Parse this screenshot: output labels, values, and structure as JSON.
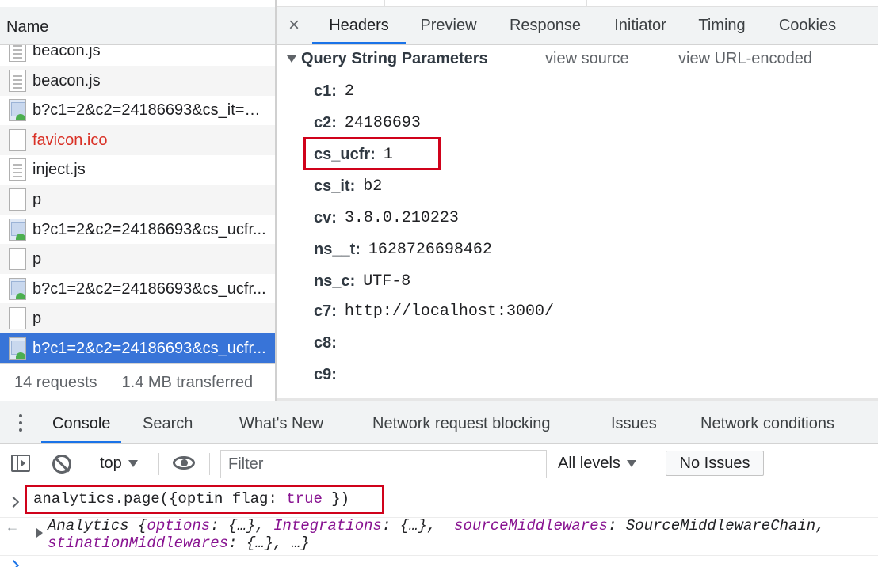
{
  "request_list": {
    "header": "Name",
    "rows": [
      {
        "label": "beacon.js",
        "icon": "script-file-icon",
        "error": false
      },
      {
        "label": "beacon.js",
        "icon": "script-file-icon",
        "error": false
      },
      {
        "label": "b?c1=2&c2=24186693&cs_it=b2...",
        "icon": "image-file-icon",
        "error": false
      },
      {
        "label": "favicon.ico",
        "icon": "blank-file-icon",
        "error": true
      },
      {
        "label": "inject.js",
        "icon": "script-file-icon",
        "error": false
      },
      {
        "label": "p",
        "icon": "blank-file-icon",
        "error": false
      },
      {
        "label": "b?c1=2&c2=24186693&cs_ucfr...",
        "icon": "image-file-icon",
        "error": false
      },
      {
        "label": "p",
        "icon": "blank-file-icon",
        "error": false
      },
      {
        "label": "b?c1=2&c2=24186693&cs_ucfr...",
        "icon": "image-file-icon",
        "error": false
      },
      {
        "label": "p",
        "icon": "blank-file-icon",
        "error": false
      },
      {
        "label": "b?c1=2&c2=24186693&cs_ucfr...",
        "icon": "image-file-icon",
        "error": false,
        "selected": true
      }
    ],
    "status_requests": "14 requests",
    "status_transferred": "1.4 MB transferred"
  },
  "detail": {
    "close_glyph": "×",
    "tabs": [
      "Headers",
      "Preview",
      "Response",
      "Initiator",
      "Timing",
      "Cookies"
    ],
    "active_tab": "Headers",
    "section_title": "Query String Parameters",
    "view_source": "view source",
    "view_url_encoded": "view URL-encoded",
    "params": [
      {
        "key": "c1:",
        "value": "2"
      },
      {
        "key": "c2:",
        "value": "24186693"
      },
      {
        "key": "cs_ucfr:",
        "value": "1"
      },
      {
        "key": "cs_it:",
        "value": "b2"
      },
      {
        "key": "cv:",
        "value": "3.8.0.210223"
      },
      {
        "key": "ns__t:",
        "value": "1628726698462"
      },
      {
        "key": "ns_c:",
        "value": "UTF-8"
      },
      {
        "key": "c7:",
        "value": "http://localhost:3000/"
      },
      {
        "key": "c8:",
        "value": ""
      },
      {
        "key": "c9:",
        "value": ""
      }
    ]
  },
  "drawer": {
    "tabs": [
      "Console",
      "Search",
      "What's New",
      "Network request blocking",
      "Issues",
      "Network conditions"
    ],
    "active_tab": "Console",
    "toolbar": {
      "context": "top",
      "filter_placeholder": "Filter",
      "levels": "All levels",
      "issues_button": "No Issues"
    },
    "console": {
      "input_prefix": "analytics.page({optin_flag: ",
      "input_keyword": "true",
      "input_suffix": " })",
      "result_line1_parts": [
        {
          "t": "Analytics {",
          "c": "cls"
        },
        {
          "t": "options",
          "c": "prop"
        },
        {
          "t": ": {…}, ",
          "c": "cls"
        },
        {
          "t": "Integrations",
          "c": "prop"
        },
        {
          "t": ": {…}, ",
          "c": "cls"
        },
        {
          "t": "_sourceMiddlewares",
          "c": "prop"
        },
        {
          "t": ": SourceMiddlewareChain, _",
          "c": "cls"
        }
      ],
      "result_line2_parts": [
        {
          "t": "stinationMiddlewares",
          "c": "prop"
        },
        {
          "t": ": {…}, …}",
          "c": "cls"
        }
      ]
    }
  },
  "colors": {
    "accent": "#1a73e8",
    "selected_row": "#3874d8",
    "error_text": "#d93025",
    "highlight_box": "#d0021b",
    "keyword": "#881391"
  }
}
